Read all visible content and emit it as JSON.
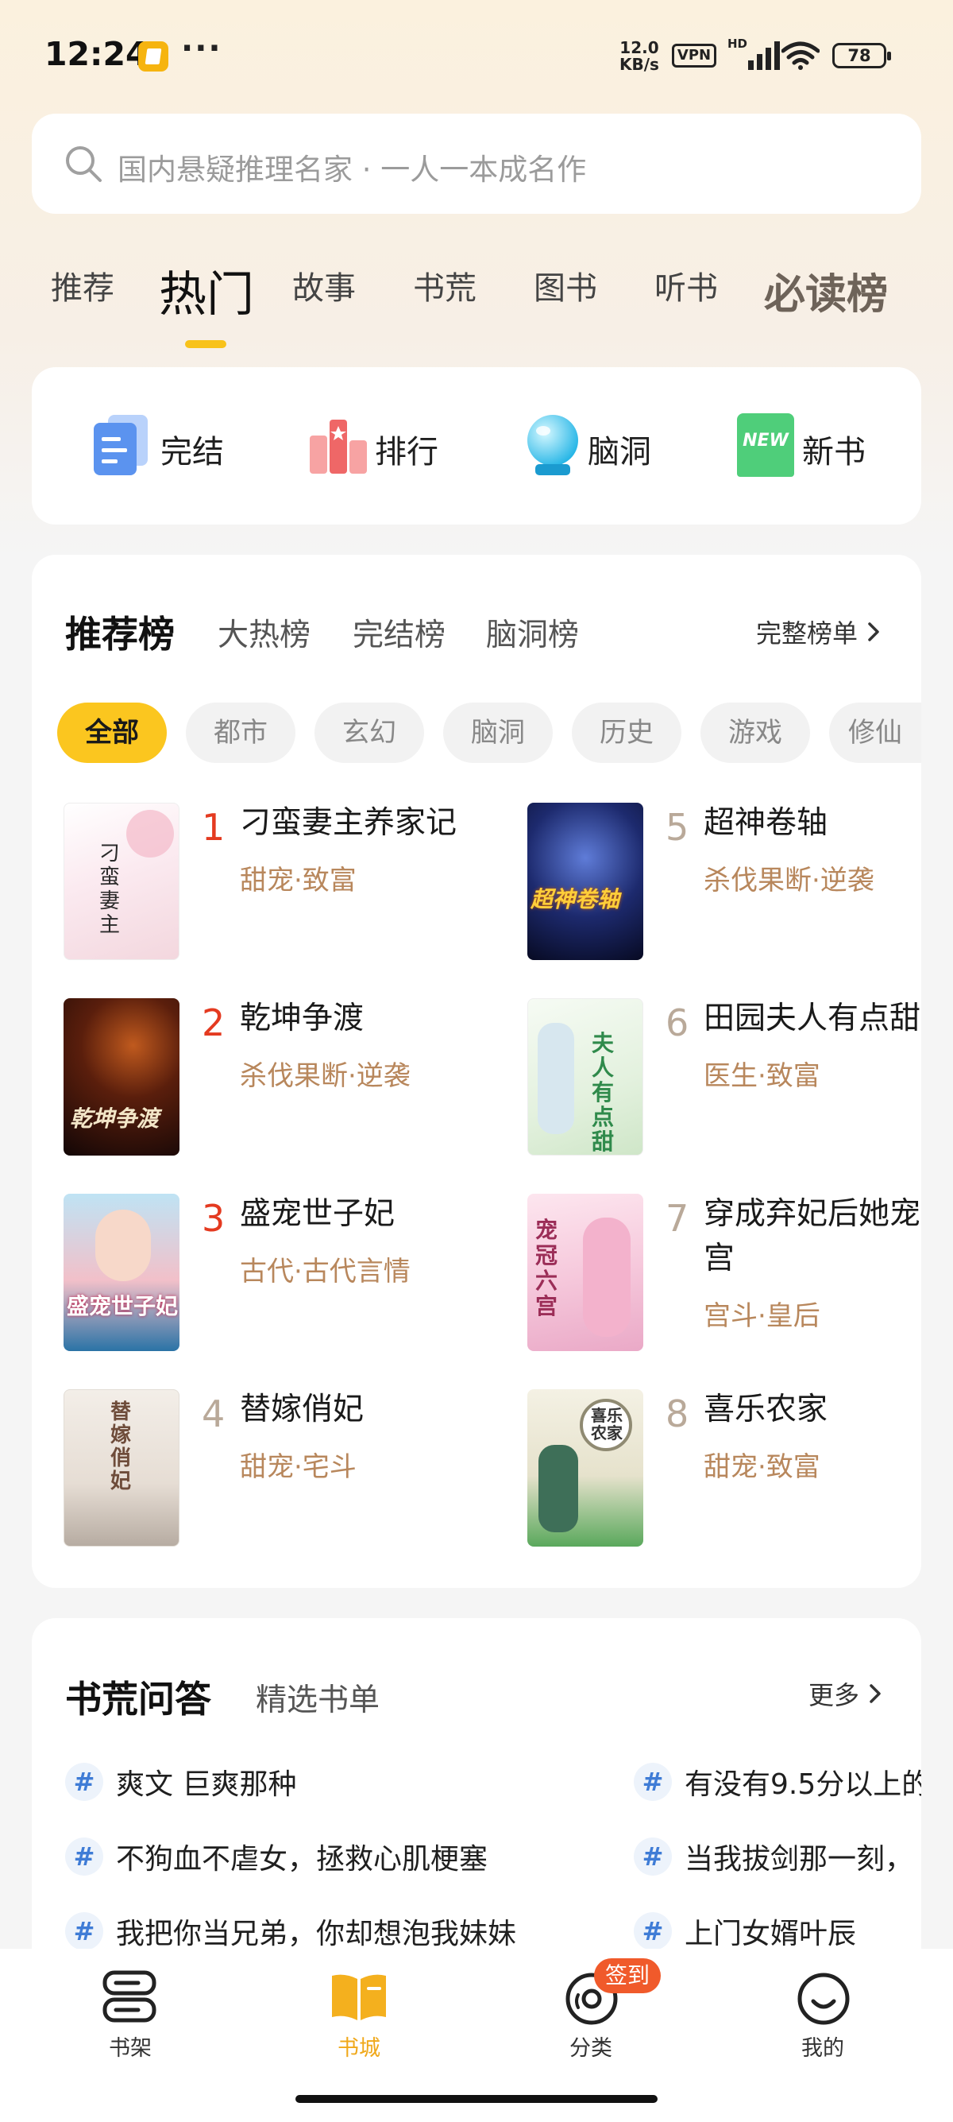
{
  "status": {
    "time": "12:24",
    "net_speed_value": "12.0",
    "net_speed_unit": "KB/s",
    "vpn": "VPN",
    "hd": "HD",
    "battery": "78",
    "more": "···"
  },
  "search": {
    "placeholder": "国内悬疑推理名家 · 一人一本成名作"
  },
  "tabs": [
    "推荐",
    "热门",
    "故事",
    "书荒",
    "图书",
    "听书",
    "必读榜"
  ],
  "active_tab": "热门",
  "quick_entries": [
    "完结",
    "排行",
    "脑洞",
    "新书"
  ],
  "new_badge": "NEW",
  "ranking": {
    "title": "推荐榜",
    "subtabs": [
      "大热榜",
      "完结榜",
      "脑洞榜"
    ],
    "full_list": "完整榜单",
    "chips": [
      "全部",
      "都市",
      "玄幻",
      "脑洞",
      "历史",
      "游戏",
      "修仙"
    ],
    "books": [
      {
        "rank": "1",
        "title": "刁蛮妻主养家记",
        "tags": "甜宠·致富",
        "cover_text": "刁蛮妻主"
      },
      {
        "rank": "2",
        "title": "乾坤争渡",
        "tags": "杀伐果断·逆袭",
        "cover_text": "乾坤争渡"
      },
      {
        "rank": "3",
        "title": "盛宠世子妃",
        "tags": "古代·古代言情",
        "cover_text": "盛宠世子妃"
      },
      {
        "rank": "4",
        "title": "替嫁俏妃",
        "tags": "甜宠·宅斗",
        "cover_text": "替嫁俏妃"
      },
      {
        "rank": "5",
        "title": "超神卷轴",
        "tags": "杀伐果断·逆袭",
        "cover_text": "超神卷轴"
      },
      {
        "rank": "6",
        "title": "田园夫人有点甜",
        "tags": "医生·致富",
        "cover_text": "夫人有点甜"
      },
      {
        "rank": "7",
        "title": "穿成弃妃后她宠冠六宫",
        "title_line2": "宫",
        "tags": "宫斗·皇后",
        "cover_text": "宠冠六宫"
      },
      {
        "rank": "8",
        "title": "喜乐农家",
        "tags": "甜宠·致富",
        "cover_text": "喜乐农家"
      }
    ]
  },
  "qa": {
    "title": "书荒问答",
    "subtitle": "精选书单",
    "more": "更多",
    "hash": "#",
    "items_left": [
      "爽文 巨爽那种",
      "不狗血不虐女，拯救心肌梗塞",
      "我把你当兄弟，你却想泡我妹妹"
    ],
    "items_right": [
      "有没有9.5分以上的",
      "当我拔剑那一刻，",
      "上门女婿叶辰"
    ]
  },
  "bottom_nav": {
    "items": [
      "书架",
      "书城",
      "分类",
      "我的"
    ],
    "active": "书城",
    "badge": "签到"
  },
  "colors": {
    "accent": "#f8c21a",
    "rank_red": "#e43a20",
    "tag_brown": "#b8875c",
    "active_nav": "#f0a81a"
  }
}
